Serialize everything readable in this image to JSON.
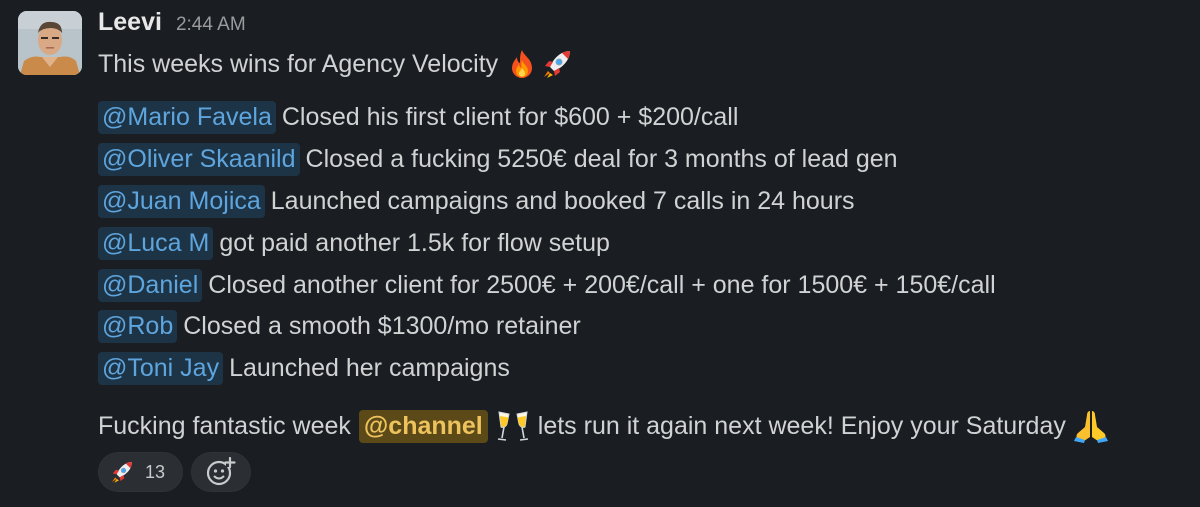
{
  "message": {
    "author": "Leevi",
    "timestamp": "2:44 AM",
    "intro_text": "This weeks wins for Agency Velocity",
    "intro_emojis": [
      "fire-emoji",
      "rocket-emoji"
    ],
    "wins": [
      {
        "mention": "@Mario Favela",
        "text": "Closed his first client for $600 + $200/call"
      },
      {
        "mention": "@Oliver Skaanild",
        "text": "Closed a fucking 5250€ deal for 3 months of lead gen"
      },
      {
        "mention": "@Juan Mojica",
        "text": "Launched campaigns and booked 7 calls in 24 hours"
      },
      {
        "mention": "@Luca M",
        "text": "got paid another 1.5k for flow setup"
      },
      {
        "mention": "@Daniel",
        "text": "Closed another client for 2500€ + 200€/call + one for 1500€ + 150€/call"
      },
      {
        "mention": "@Rob",
        "text": "Closed a smooth $1300/mo retainer"
      },
      {
        "mention": "@Toni Jay",
        "text": "Launched her campaigns"
      }
    ],
    "outro": {
      "before": "Fucking fantastic week",
      "channel_mention": "@channel",
      "after": "lets run it again next week! Enjoy your Saturday",
      "emojis": [
        "champagne-glasses-emoji",
        "folded-hands-emoji"
      ]
    }
  },
  "reactions": [
    {
      "emoji": "rocket-emoji",
      "count": "13"
    }
  ],
  "add_reaction_icon": "add-emoji-icon",
  "colors": {
    "background": "#1a1d21",
    "text": "#d1d2d3",
    "user_mention_bg": "#1d3447",
    "user_mention_text": "#5fa5dd",
    "channel_mention_bg": "#5b4a17",
    "channel_mention_text": "#eec35d",
    "reaction_pill_bg": "#2b2e33"
  }
}
